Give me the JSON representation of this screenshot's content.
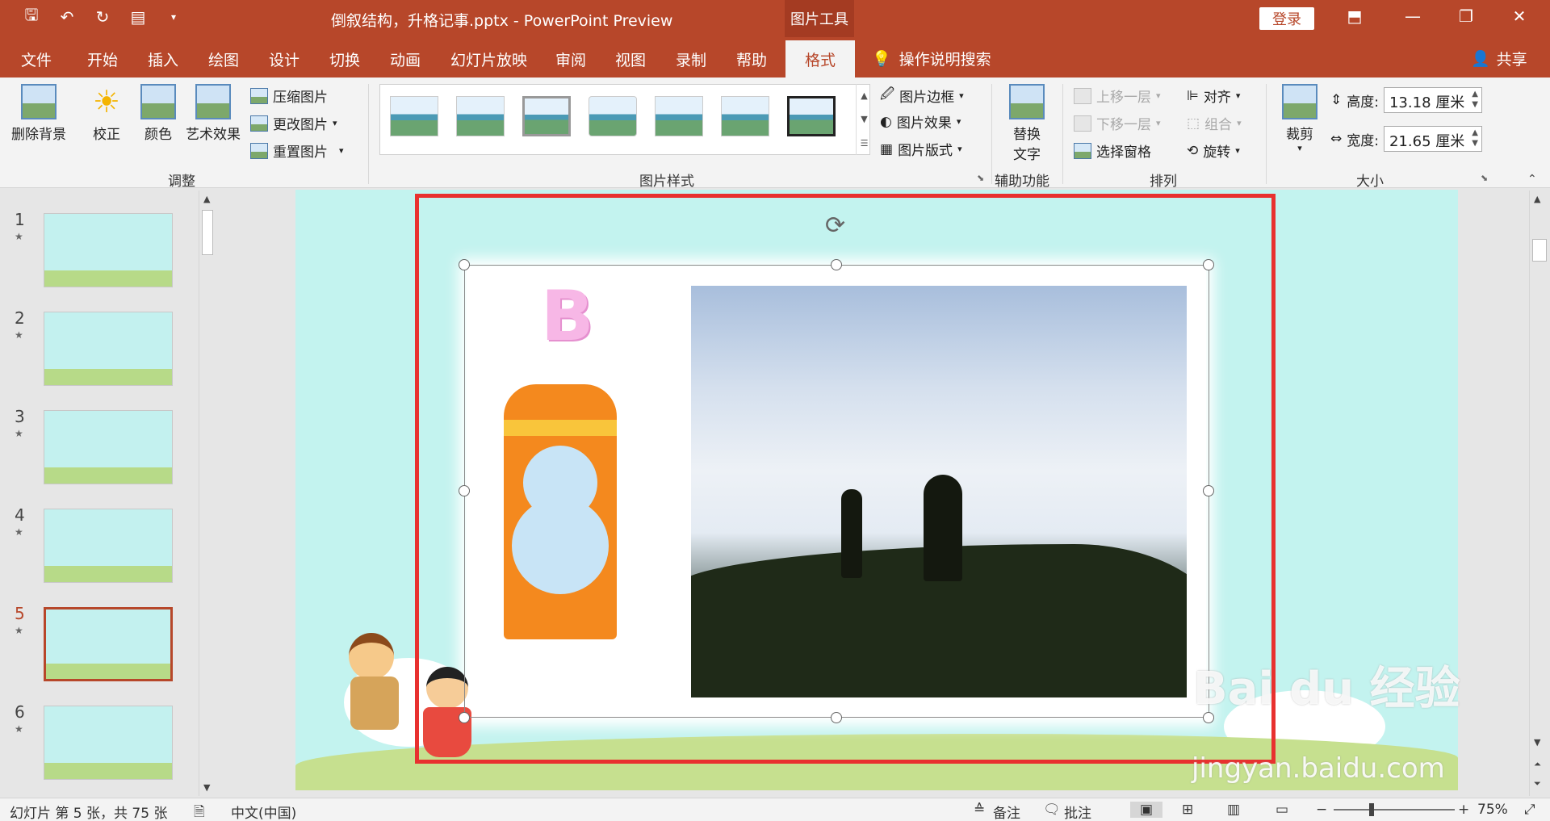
{
  "titlebar": {
    "doc_title": "倒叙结构，升格记事.pptx  -  PowerPoint Preview",
    "tool_tab": "图片工具",
    "login": "登录"
  },
  "tabs": [
    "文件",
    "开始",
    "插入",
    "绘图",
    "设计",
    "切换",
    "动画",
    "幻灯片放映",
    "审阅",
    "视图",
    "录制",
    "帮助"
  ],
  "active_tab": "格式",
  "search_label": "操作说明搜索",
  "share_label": "共享",
  "ribbon": {
    "adjust": {
      "remove_bg": "删除背景",
      "correct": "校正",
      "color": "颜色",
      "art": "艺术效果",
      "compress": "压缩图片",
      "change": "更改图片",
      "reset": "重置图片",
      "label": "调整"
    },
    "styles": {
      "border": "图片边框",
      "effect": "图片效果",
      "layout": "图片版式",
      "label": "图片样式"
    },
    "access": {
      "alt_text_1": "替换",
      "alt_text_2": "文字",
      "label": "辅助功能"
    },
    "arrange": {
      "forward": "上移一层",
      "backward": "下移一层",
      "pane": "选择窗格",
      "align": "对齐",
      "group": "组合",
      "rotate": "旋转",
      "label": "排列"
    },
    "size": {
      "crop": "裁剪",
      "height_label": "高度:",
      "height_value": "13.18 厘米",
      "width_label": "宽度:",
      "width_value": "21.65 厘米",
      "label": "大小"
    }
  },
  "thumbnails": [
    {
      "num": "1",
      "active": false
    },
    {
      "num": "2",
      "active": false
    },
    {
      "num": "3",
      "active": false
    },
    {
      "num": "4",
      "active": false
    },
    {
      "num": "5",
      "active": true
    },
    {
      "num": "6",
      "active": false
    }
  ],
  "slide": {
    "big_letter": "B"
  },
  "status": {
    "slide_info": "幻灯片 第 5 张，共 75 张",
    "language": "中文(中国)",
    "notes": "备注",
    "comments": "批注",
    "zoom": "75%"
  },
  "watermark": {
    "line1": "Bai du 经验",
    "line2": "jingyan.baidu.com"
  },
  "colors": {
    "accent": "#b7472a",
    "slide_bg": "#c3f3ef",
    "frame": "#e8312f"
  }
}
